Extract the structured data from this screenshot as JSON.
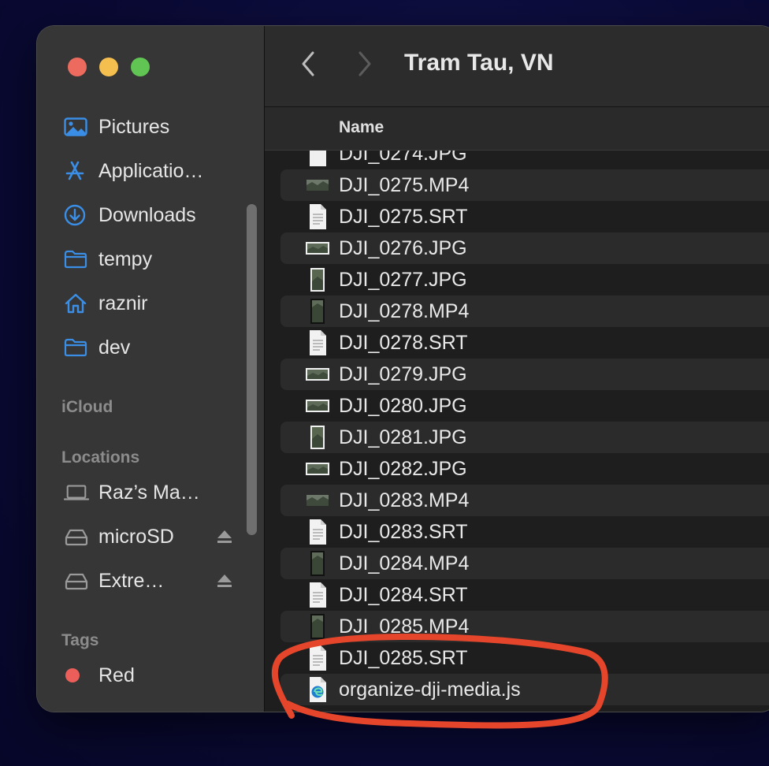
{
  "window": {
    "title": "Tram Tau, VN",
    "nav": {
      "back": "back-icon",
      "forward": "forward-icon"
    }
  },
  "sidebar": {
    "favorites": [
      {
        "label": "Pictures",
        "icon": "pictures-icon"
      },
      {
        "label": "Applicatio…",
        "icon": "applications-icon"
      },
      {
        "label": "Downloads",
        "icon": "downloads-icon"
      },
      {
        "label": "tempy",
        "icon": "folder-icon"
      },
      {
        "label": "raznir",
        "icon": "home-icon"
      },
      {
        "label": "dev",
        "icon": "folder-icon"
      }
    ],
    "icloud_header": "iCloud",
    "locations_header": "Locations",
    "locations": [
      {
        "label": "Raz’s Ma…",
        "icon": "laptop-icon"
      },
      {
        "label": "microSD",
        "icon": "drive-icon",
        "eject": true
      },
      {
        "label": "Extre…",
        "icon": "drive-icon",
        "eject": true
      }
    ],
    "tags_header": "Tags",
    "tags": [
      {
        "label": "Red",
        "color": "#ec5e5a"
      }
    ]
  },
  "list": {
    "column_name": "Name",
    "partial_top": "DJI_0274.JPG",
    "files": [
      {
        "name": "DJI_0275.MP4",
        "kind": "video-wide"
      },
      {
        "name": "DJI_0275.SRT",
        "kind": "text"
      },
      {
        "name": "DJI_0276.JPG",
        "kind": "image-wide"
      },
      {
        "name": "DJI_0277.JPG",
        "kind": "image-tall"
      },
      {
        "name": "DJI_0278.MP4",
        "kind": "video-tall"
      },
      {
        "name": "DJI_0278.SRT",
        "kind": "text"
      },
      {
        "name": "DJI_0279.JPG",
        "kind": "image-wide"
      },
      {
        "name": "DJI_0280.JPG",
        "kind": "image-wide"
      },
      {
        "name": "DJI_0281.JPG",
        "kind": "image-tall"
      },
      {
        "name": "DJI_0282.JPG",
        "kind": "image-wide"
      },
      {
        "name": "DJI_0283.MP4",
        "kind": "video-wide"
      },
      {
        "name": "DJI_0283.SRT",
        "kind": "text"
      },
      {
        "name": "DJI_0284.MP4",
        "kind": "video-tall"
      },
      {
        "name": "DJI_0284.SRT",
        "kind": "text"
      },
      {
        "name": "DJI_0285.MP4",
        "kind": "video-tall"
      },
      {
        "name": "DJI_0285.SRT",
        "kind": "text"
      },
      {
        "name": "organize-dji-media.js",
        "kind": "script"
      }
    ]
  },
  "annotation": {
    "color": "#e5462b"
  }
}
